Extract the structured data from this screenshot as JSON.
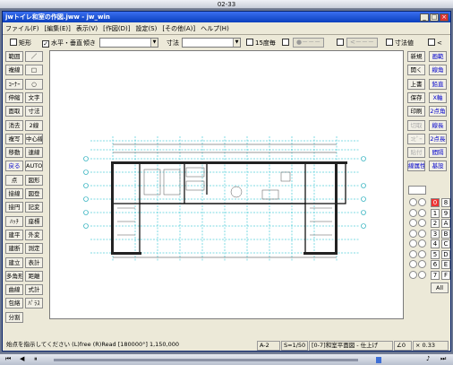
{
  "top_title": "02-33",
  "window": {
    "title": "jwトイレ和室の作図.jww - jw_win",
    "min": "_",
    "max": "□",
    "close": "×"
  },
  "menus": [
    "ファイル(F)",
    "[編集(E)]",
    "表示(V)",
    "[作図(D)]",
    "設定(S)",
    "[その他(A)]",
    "ヘルプ(H)"
  ],
  "toolbar": {
    "rect_label": "矩形",
    "hv_label": "水平・垂直",
    "slope_label": "傾き",
    "size_label": "寸法",
    "deg15_label": "15度毎",
    "arrow1": "●－－－",
    "arrow2": "<－－－",
    "dimval_label": "寸法値",
    "lt_label": "<"
  },
  "left_tools": [
    [
      "範囲",
      "／"
    ],
    [
      "複線",
      "□"
    ],
    [
      "ｺｰﾅｰ",
      "○"
    ],
    [
      "伸縮",
      "文字"
    ],
    [
      "面取",
      "寸法"
    ],
    [
      "消去",
      "2線"
    ],
    [
      "複写",
      "中心線"
    ],
    [
      "移動",
      "連線"
    ],
    [
      "戻る",
      "AUTO"
    ],
    [
      "点",
      "図形"
    ],
    [
      "接線",
      "図登"
    ],
    [
      "接円",
      "記変"
    ],
    [
      "ﾊｯﾁ",
      "座標"
    ],
    [
      "建平",
      "外変"
    ],
    [
      "建断",
      "測定"
    ],
    [
      "建立",
      "表計"
    ],
    [
      "多角形",
      "距離"
    ],
    [
      "曲線",
      "式計"
    ],
    [
      "包絡",
      "ﾊﾟﾗｽ"
    ],
    [
      "分割",
      ""
    ]
  ],
  "right_tools": [
    [
      "新規",
      "画範"
    ],
    [
      "開く",
      "線角"
    ],
    [
      "上書",
      "鉛直"
    ],
    [
      "保存",
      "X軸"
    ],
    [
      "印刷",
      "2点角"
    ],
    [
      "切取",
      "線長"
    ],
    [
      "ｺﾋﾟｰ",
      "2点長"
    ],
    [
      "貼付",
      "間隔"
    ],
    [
      "線属性",
      "基設"
    ]
  ],
  "layer_numbers": [
    "0",
    "1",
    "2",
    "3",
    "4",
    "5",
    "6",
    "7",
    "8",
    "9",
    "A",
    "B",
    "C",
    "D",
    "E",
    "F"
  ],
  "all_label": "All",
  "status": {
    "message": "始点を指示してください (L)free (R)Read [180000°] 1,150,000",
    "paper": "A-2",
    "scale": "S=1/50",
    "layer": "[0-7]和室平面図 - 仕上げ",
    "angle": "∠0",
    "zoom": "× 0.33"
  }
}
